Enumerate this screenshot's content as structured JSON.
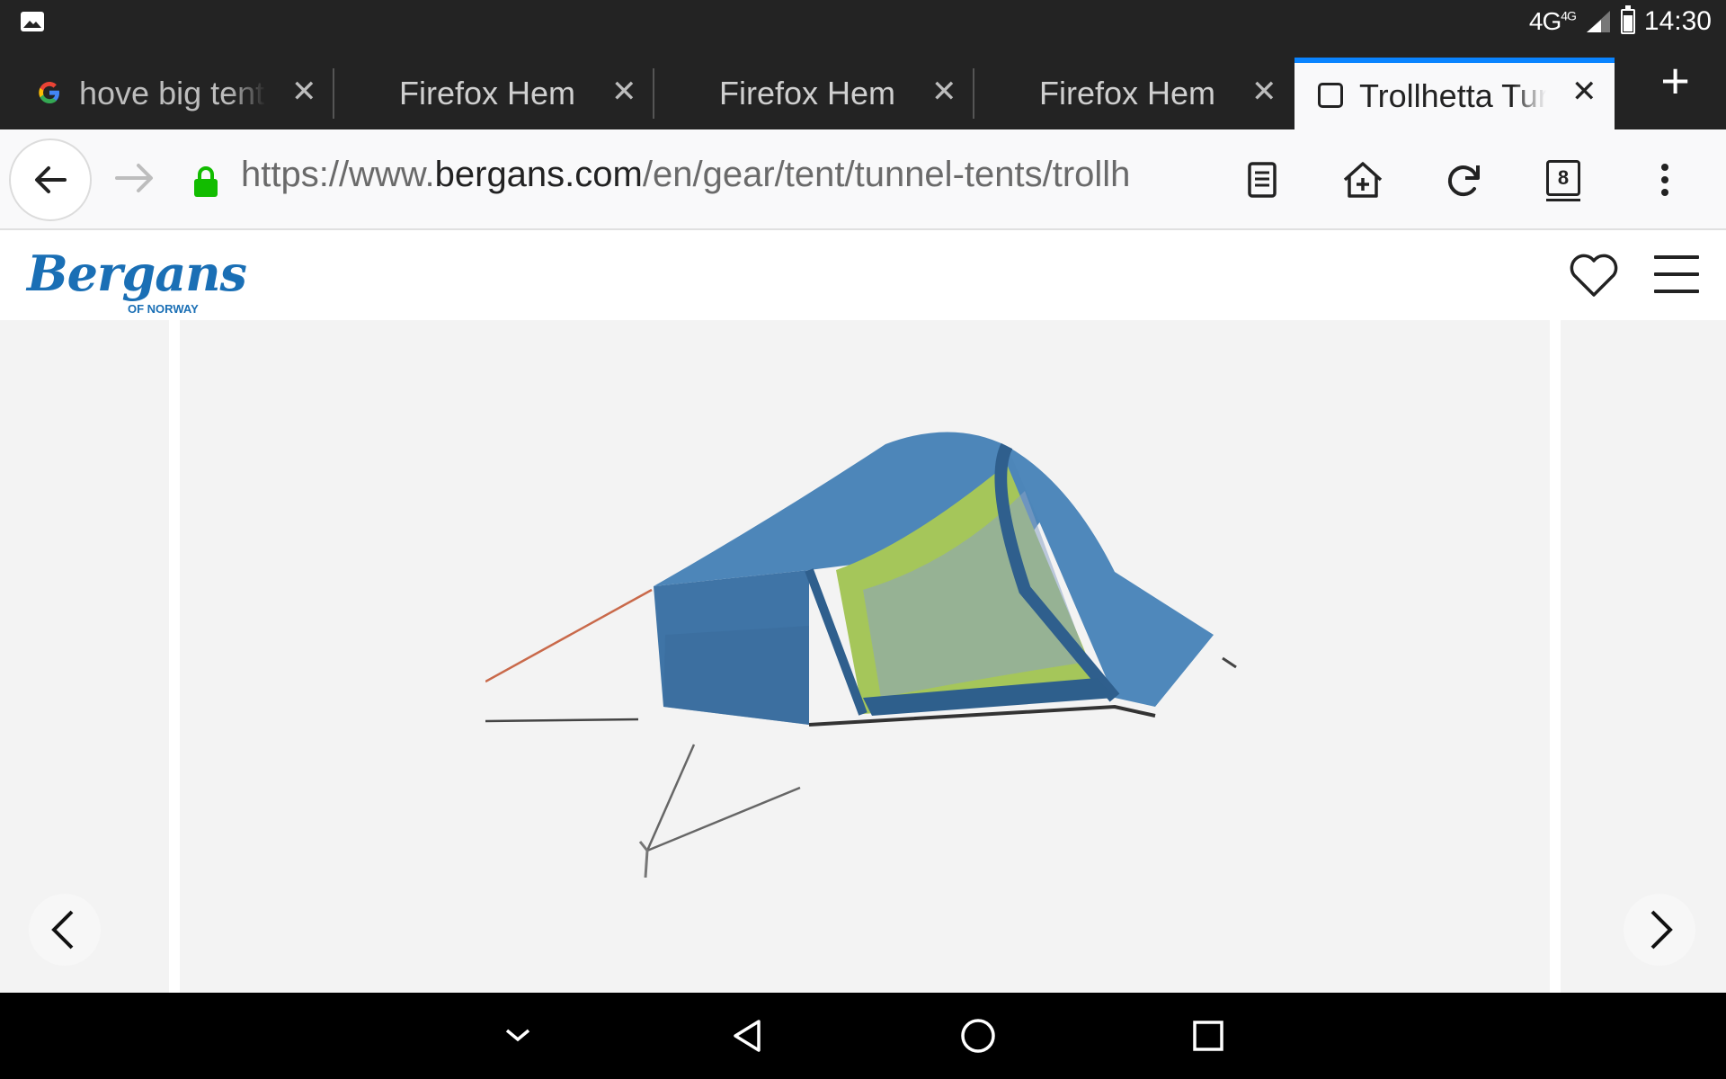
{
  "status_bar": {
    "network": "4G",
    "network_sub": "4G",
    "time": "14:30",
    "icons": [
      "image-notification-icon",
      "signal-icon",
      "battery-icon"
    ]
  },
  "tabs": [
    {
      "title": "hove big tent",
      "favicon": "google-icon",
      "active": false
    },
    {
      "title": "Firefox Hem",
      "active": false
    },
    {
      "title": "Firefox Hem",
      "active": false
    },
    {
      "title": "Firefox Hem",
      "active": false
    },
    {
      "title": "Trollhetta Tur",
      "favicon": "page-icon",
      "active": true
    }
  ],
  "toolbar": {
    "url_prefix": "https://www.",
    "url_host": "bergans.com",
    "url_path": "/en/gear/tent/tunnel-tents/trollh",
    "tab_count": "8",
    "icons": [
      "back-icon",
      "forward-icon",
      "lock-icon",
      "reader-mode-icon",
      "add-to-home-icon",
      "reload-icon",
      "tabs-counter-icon",
      "overflow-menu-icon"
    ]
  },
  "site": {
    "logo_text": "Bergans",
    "logo_sub": "OF NORWAY",
    "brand_color": "#1a6fb5",
    "icons": [
      "heart-icon",
      "hamburger-menu-icon"
    ]
  },
  "gallery": {
    "image": "tunnel tent product photo",
    "icons": [
      "chevron-left-icon",
      "chevron-right-icon"
    ]
  },
  "nav_bar": {
    "icons": [
      "hide-keyboard-icon",
      "back-triangle-icon",
      "home-circle-icon",
      "recents-square-icon"
    ]
  }
}
